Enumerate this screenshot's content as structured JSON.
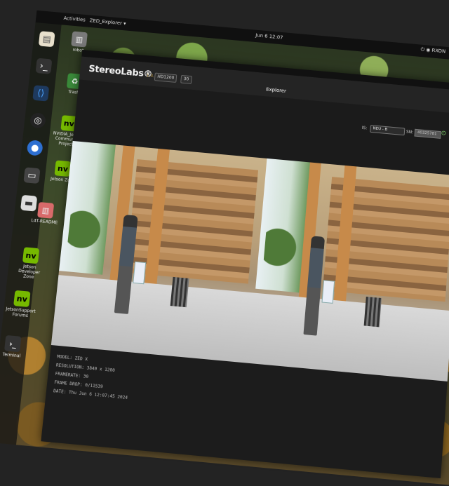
{
  "topbar": {
    "activities": "Activities",
    "app_menu": "ZED_Explorer ▾",
    "clock": "Jun 6 12:07",
    "status": "⏻  ◉ RXON"
  },
  "dock": {
    "icons": [
      "files-icon",
      "terminal-icon",
      "vscode-icon",
      "obs-icon",
      "chromium-icon",
      "drive-icon",
      "usb-icon"
    ]
  },
  "desktop_icons": [
    {
      "label": "robot",
      "icon": "folder-icon"
    },
    {
      "label": "Trash",
      "icon": "trash-icon"
    },
    {
      "label": "NVIDIA_Jetson Community Projects",
      "icon": "nvidia-icon"
    },
    {
      "label": "Jetson Zoo",
      "icon": "nvidia-icon"
    },
    {
      "label": "L4T-README",
      "icon": "folder-icon"
    },
    {
      "label": "Jetson Developer Zone",
      "icon": "nvidia-icon"
    },
    {
      "label": "JetsonSupport Forums",
      "icon": "nvidia-icon"
    },
    {
      "label": "Terminal",
      "icon": "terminal-icon"
    }
  ],
  "app": {
    "logo": "StereoLabs®",
    "version": "1.3.0",
    "resolution_select": "HD1200",
    "fps_select": "30",
    "title": "Explorer",
    "window_controls": "–  □",
    "toolbar": {
      "side_label": "IS:",
      "side_select": "NEU - B",
      "sn_label": "SN:",
      "sn_value": "40325781",
      "record_icon": "record-icon",
      "settings_icon": "settings-icon"
    },
    "info": {
      "model": "MODEL: ZED X",
      "resolution": "RESOLUTION: 3840 x 1200",
      "framerate": "FRAMERATE: 30",
      "frame_drop": "FRAME DROP: 0/11539",
      "date": "DATE: Thu Jun 6 12:07:45 2024"
    }
  }
}
